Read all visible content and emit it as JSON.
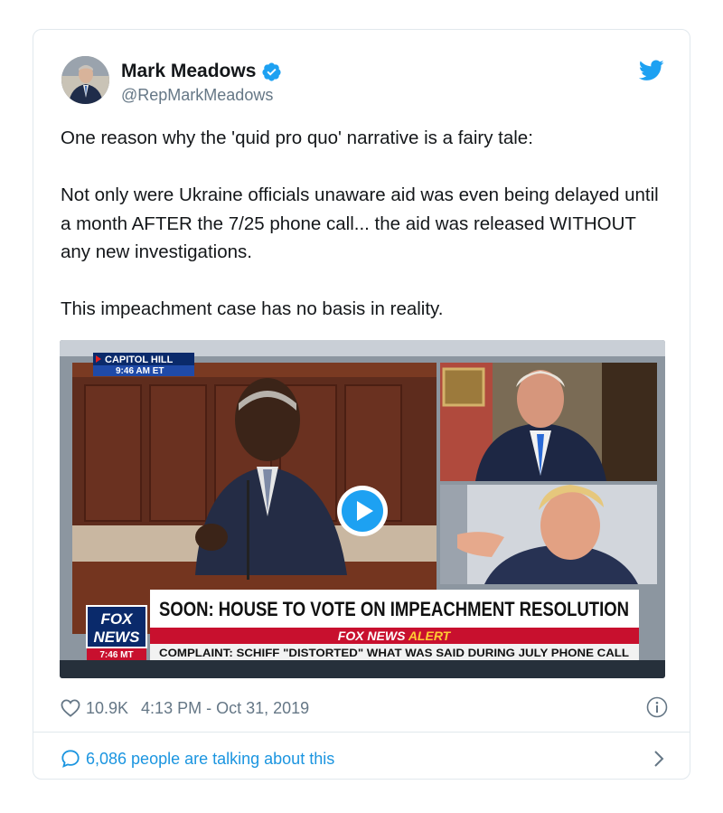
{
  "author": {
    "name": "Mark Meadows",
    "handle": "@RepMarkMeadows",
    "verified": true
  },
  "tweet": {
    "paragraphs": [
      "One reason why the 'quid pro quo' narrative is a fairy tale:",
      "Not only were Ukraine officials unaware aid was even being delayed until a month AFTER the 7/25 phone call... the aid was released WITHOUT any new investigations.",
      "This impeachment case has no basis in reality."
    ]
  },
  "media": {
    "location": "CAPITOL HILL",
    "location_time": "9:46 AM ET",
    "headline": "SOON: HOUSE TO VOTE ON IMPEACHMENT RESOLUTION",
    "alert_brand": "FOX NEWS",
    "alert_word": "ALERT",
    "ticker": "COMPLAINT: SCHIFF \"DISTORTED\" WHAT WAS SAID DURING JULY PHONE CALL",
    "logo_line1": "FOX",
    "logo_line2": "NEWS",
    "clock": "7:46 MT"
  },
  "footer": {
    "likes": "10.9K",
    "timestamp": "4:13 PM - Oct 31, 2019",
    "talking": "6,086 people are talking about this"
  },
  "icons": {
    "brand": "twitter-bird-icon",
    "verified": "verified-badge-icon",
    "like": "heart-icon",
    "info": "info-icon",
    "conversation": "speech-bubble-icon",
    "play": "play-icon",
    "chevron": "chevron-right-icon"
  },
  "colors": {
    "twitter_blue": "#1da1f2",
    "link_blue": "#1b95e0",
    "muted": "#657786",
    "fox_red": "#c8102e",
    "fox_navy": "#0a2a6b"
  }
}
